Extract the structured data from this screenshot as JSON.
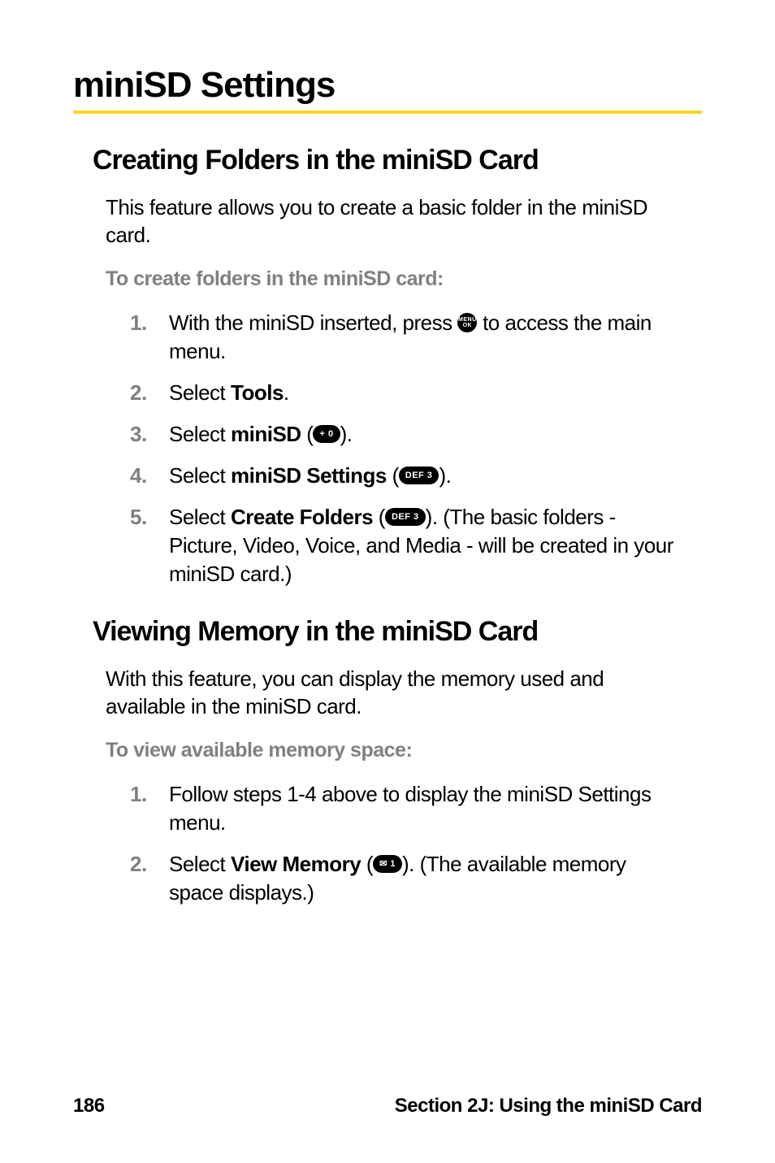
{
  "title": "miniSD Settings",
  "section1": {
    "heading": "Creating Folders in the miniSD Card",
    "intro": "This feature allows you to create a basic folder in the miniSD card.",
    "subhead": "To create folders in the miniSD card:",
    "steps": [
      {
        "num": "1.",
        "pre": "With the miniSD inserted, press ",
        "key": "MENU\nOK",
        "post": " to access the main menu."
      },
      {
        "num": "2.",
        "pre": "Select ",
        "bold": "Tools",
        "post": "."
      },
      {
        "num": "3.",
        "pre": "Select ",
        "bold": "miniSD",
        "post1": " (",
        "key": "+ 0",
        "post2": ")."
      },
      {
        "num": "4.",
        "pre": "Select ",
        "bold": "miniSD Settings",
        "post1": " (",
        "key": "DEF 3",
        "post2": ")."
      },
      {
        "num": "5.",
        "pre": "Select ",
        "bold": "Create Folders",
        "post1": " (",
        "key": "DEF 3",
        "post2": "). (The basic folders - Picture, Video, Voice, and Media - will be created in your miniSD card.)"
      }
    ]
  },
  "section2": {
    "heading": "Viewing Memory in the miniSD Card",
    "intro": "With this feature, you can display the memory used and available in the miniSD card.",
    "subhead": "To view available memory space:",
    "steps": [
      {
        "num": "1.",
        "text": "Follow steps 1-4 above to display the miniSD Settings menu."
      },
      {
        "num": "2.",
        "pre": "Select ",
        "bold": "View Memory",
        "post1": " (",
        "key": "✉ 1",
        "post2": "). (The available memory space displays.)"
      }
    ]
  },
  "footer": {
    "page": "186",
    "section": "Section 2J: Using the miniSD Card"
  }
}
